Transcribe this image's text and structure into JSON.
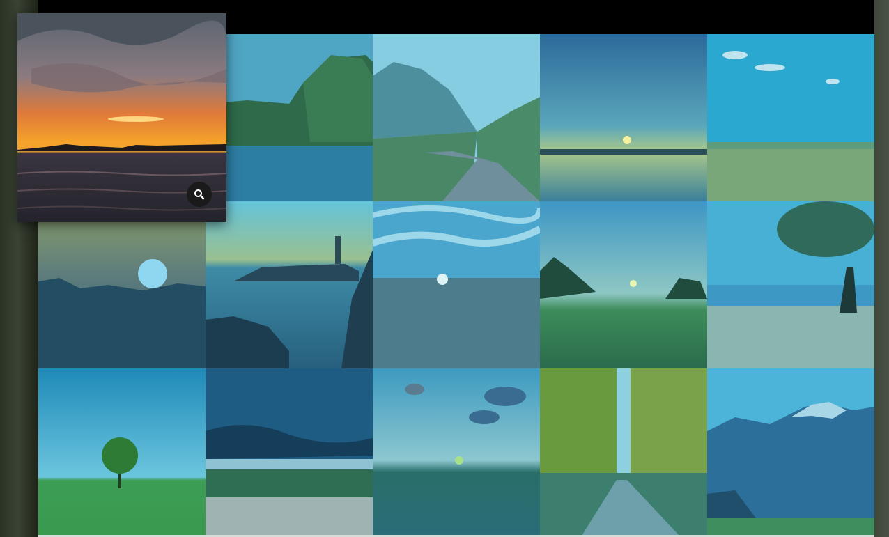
{
  "gallery": {
    "featured_image": "sunset-over-lake-thumbnail",
    "zoom_icon": "magnifier-icon",
    "tile_tint_color": "#2e9cc8",
    "tiles": [
      "lake-with-forest",
      "foggy-mountain-road",
      "sunrise-reflection-lake",
      "wheat-field-blue-sky",
      "sun-over-treeline",
      "lighthouse-on-rocks",
      "sunburst-over-field",
      "green-meadow-sunset",
      "lone-tree-by-lake",
      "lone-tree-in-meadow",
      "storm-clouds-over-wheat",
      "clouds-over-dusk-field",
      "forest-dirt-road",
      "snowy-mountain-range"
    ]
  }
}
